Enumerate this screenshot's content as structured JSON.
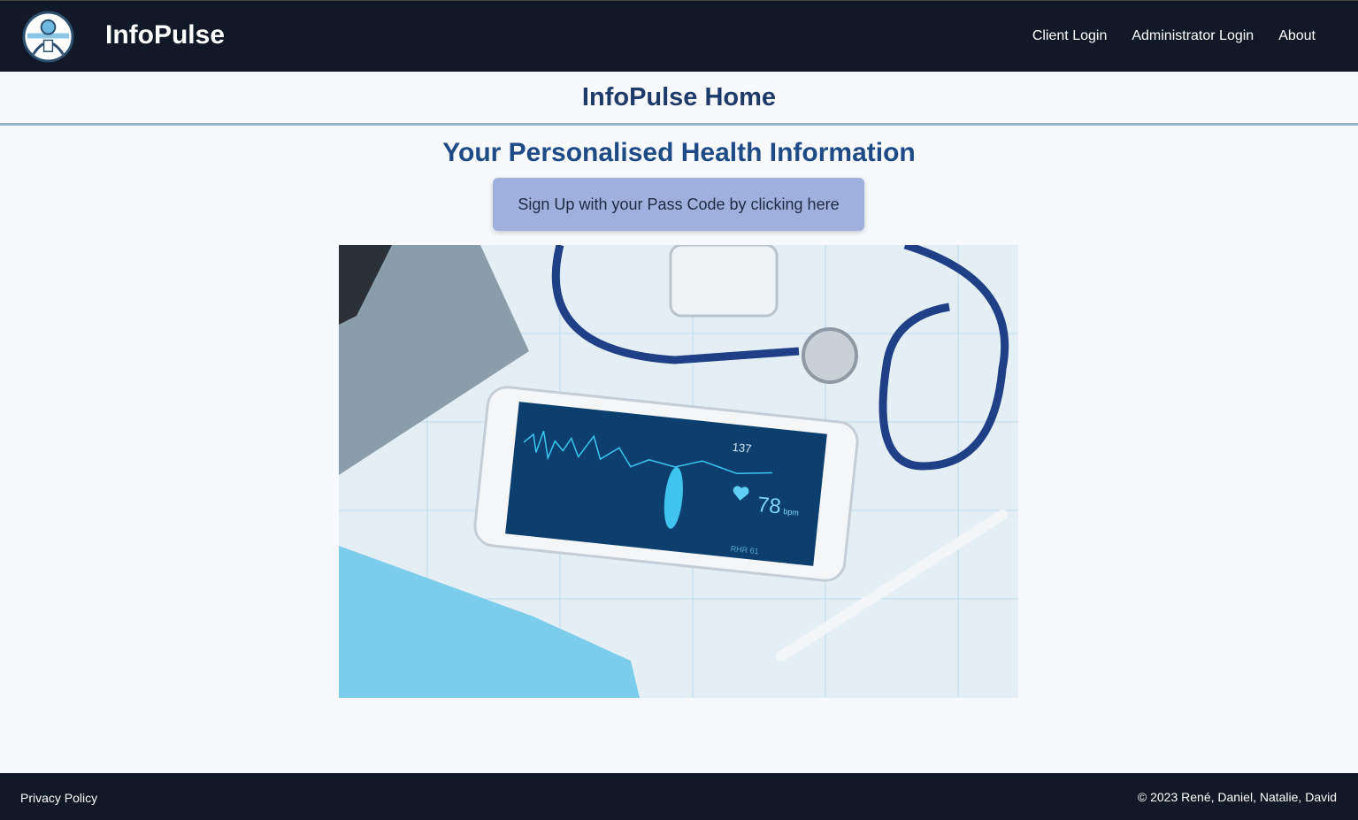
{
  "nav": {
    "brand": "InfoPulse",
    "links": [
      "Client Login",
      "Administrator Login",
      "About"
    ]
  },
  "page": {
    "title": "InfoPulse Home",
    "subtitle": "Your Personalised Health Information",
    "signup_button": "Sign Up with your Pass Code by clicking here"
  },
  "hero": {
    "screen_values": {
      "count": "137",
      "bpm": "78",
      "bpm_unit": "bpm",
      "rhr": "RHR 61"
    }
  },
  "footer": {
    "privacy": "Privacy Policy",
    "copyright": "© 2023 René, Daniel, Natalie, David"
  },
  "colors": {
    "nav_bg": "#111827",
    "heading": "#1e4a85",
    "button_bg": "#9fb0dc"
  }
}
